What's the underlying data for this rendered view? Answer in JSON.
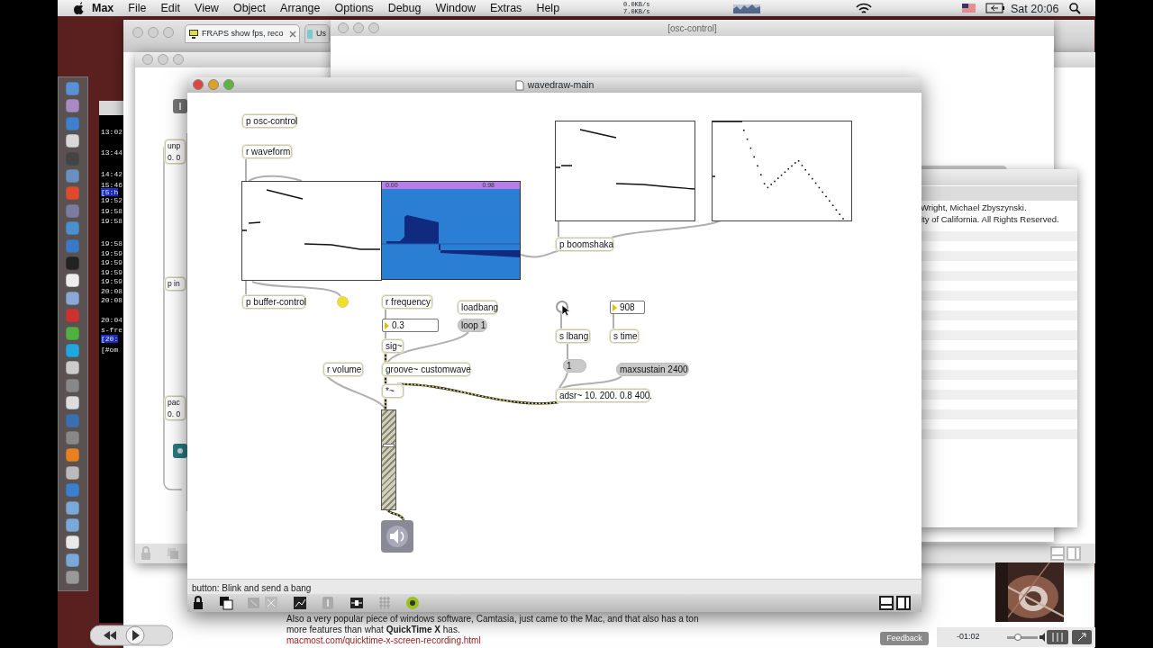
{
  "menu_bar": {
    "app": "Max",
    "items": [
      "File",
      "Edit",
      "View",
      "Object",
      "Arrange",
      "Options",
      "Debug",
      "Window",
      "Extras",
      "Help"
    ],
    "network_up": "0.0KB/s",
    "network_down": "7.0KB/s",
    "clock": "Sat 20:06"
  },
  "terminal_lines": [
    "13:02",
    "13:44",
    "14:42",
    "15:46",
    "[5:h",
    "19:52",
    "19:58",
    "19:58",
    "19:58",
    "19:59",
    "19:59",
    "19:59",
    "19:59",
    "20:08",
    "20:08",
    "20:04",
    "s-fre",
    "[20:",
    "[#om"
  ],
  "browser_tabs": [
    {
      "label": "FRAPS show fps, reco",
      "selected": true
    },
    {
      "label": "Us",
      "selected": false
    }
  ],
  "osc_window": {
    "title": "[osc-control]"
  },
  "side_patch_texts": [
    "unp",
    "0. 0",
    "p in",
    "pac",
    "0. 0"
  ],
  "about_window": {
    "lines": [
      "Wright, Michael Zbyszynski.",
      "ity of California. All Rights Reserved."
    ]
  },
  "main_window": {
    "title": "wavedraw-main",
    "status": "button: Blink and send a bang"
  },
  "waveform_header": {
    "start": "0.00",
    "end": "0.98"
  },
  "patcher_objects": [
    {
      "kind": "object",
      "text": "p osc-control"
    },
    {
      "kind": "object",
      "text": "r waveform"
    },
    {
      "kind": "object",
      "text": "p buffer-control"
    },
    {
      "kind": "led",
      "on": true
    },
    {
      "kind": "object",
      "text": "r frequency"
    },
    {
      "kind": "number",
      "text": "0.3"
    },
    {
      "kind": "object",
      "text": "loadbang"
    },
    {
      "kind": "message",
      "text": "loop 1"
    },
    {
      "kind": "object",
      "text": "sig~"
    },
    {
      "kind": "object",
      "text": "r volume"
    },
    {
      "kind": "object",
      "text": "groove~ customwave"
    },
    {
      "kind": "object",
      "text": "*~"
    },
    {
      "kind": "object",
      "text": "p boomshaka"
    },
    {
      "kind": "bang",
      "on": false
    },
    {
      "kind": "number",
      "text": "908"
    },
    {
      "kind": "object",
      "text": "s lbang"
    },
    {
      "kind": "object",
      "text": "s time"
    },
    {
      "kind": "message",
      "text": "1"
    },
    {
      "kind": "message",
      "text": "maxsustain 2400"
    },
    {
      "kind": "object",
      "text": "adsr~ 10. 200. 0.8 400."
    }
  ],
  "gain_slider": {
    "level": 0.66
  },
  "web_text": {
    "line_1": "Also a very popular piece of windows software, Camtasia, just came to the Mac, and that also has a ton",
    "line_2": "more features than what **QuickTime X** has.",
    "link": "macmost.com/quicktime-x-screen-recording.html"
  },
  "feedback_button": "Feedback",
  "video_player": {
    "time": "-01:02",
    "volume": {
      "level": 0.35
    }
  }
}
